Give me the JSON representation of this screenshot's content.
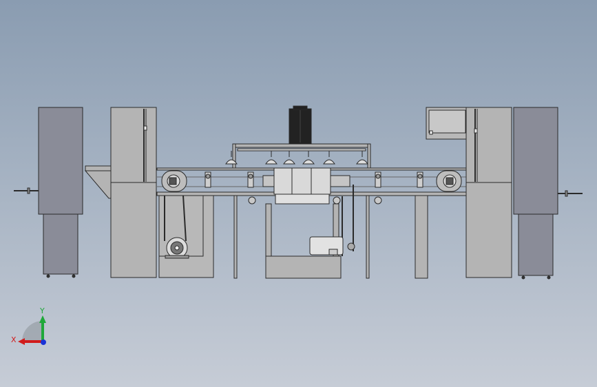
{
  "viewport": {
    "background_top": "#8a9cb1",
    "background_bottom": "#c6ccd6"
  },
  "triad": {
    "x_label": "X",
    "y_label": "Y",
    "x_color": "#d11b1b",
    "y_color": "#1fa83a",
    "z_color": "#1a33d6"
  },
  "model": {
    "body_color": "#b4b4b4",
    "side_panel_color": "#8a8c98",
    "edge_color": "#2a2a2a",
    "motor_color": "#222222"
  }
}
